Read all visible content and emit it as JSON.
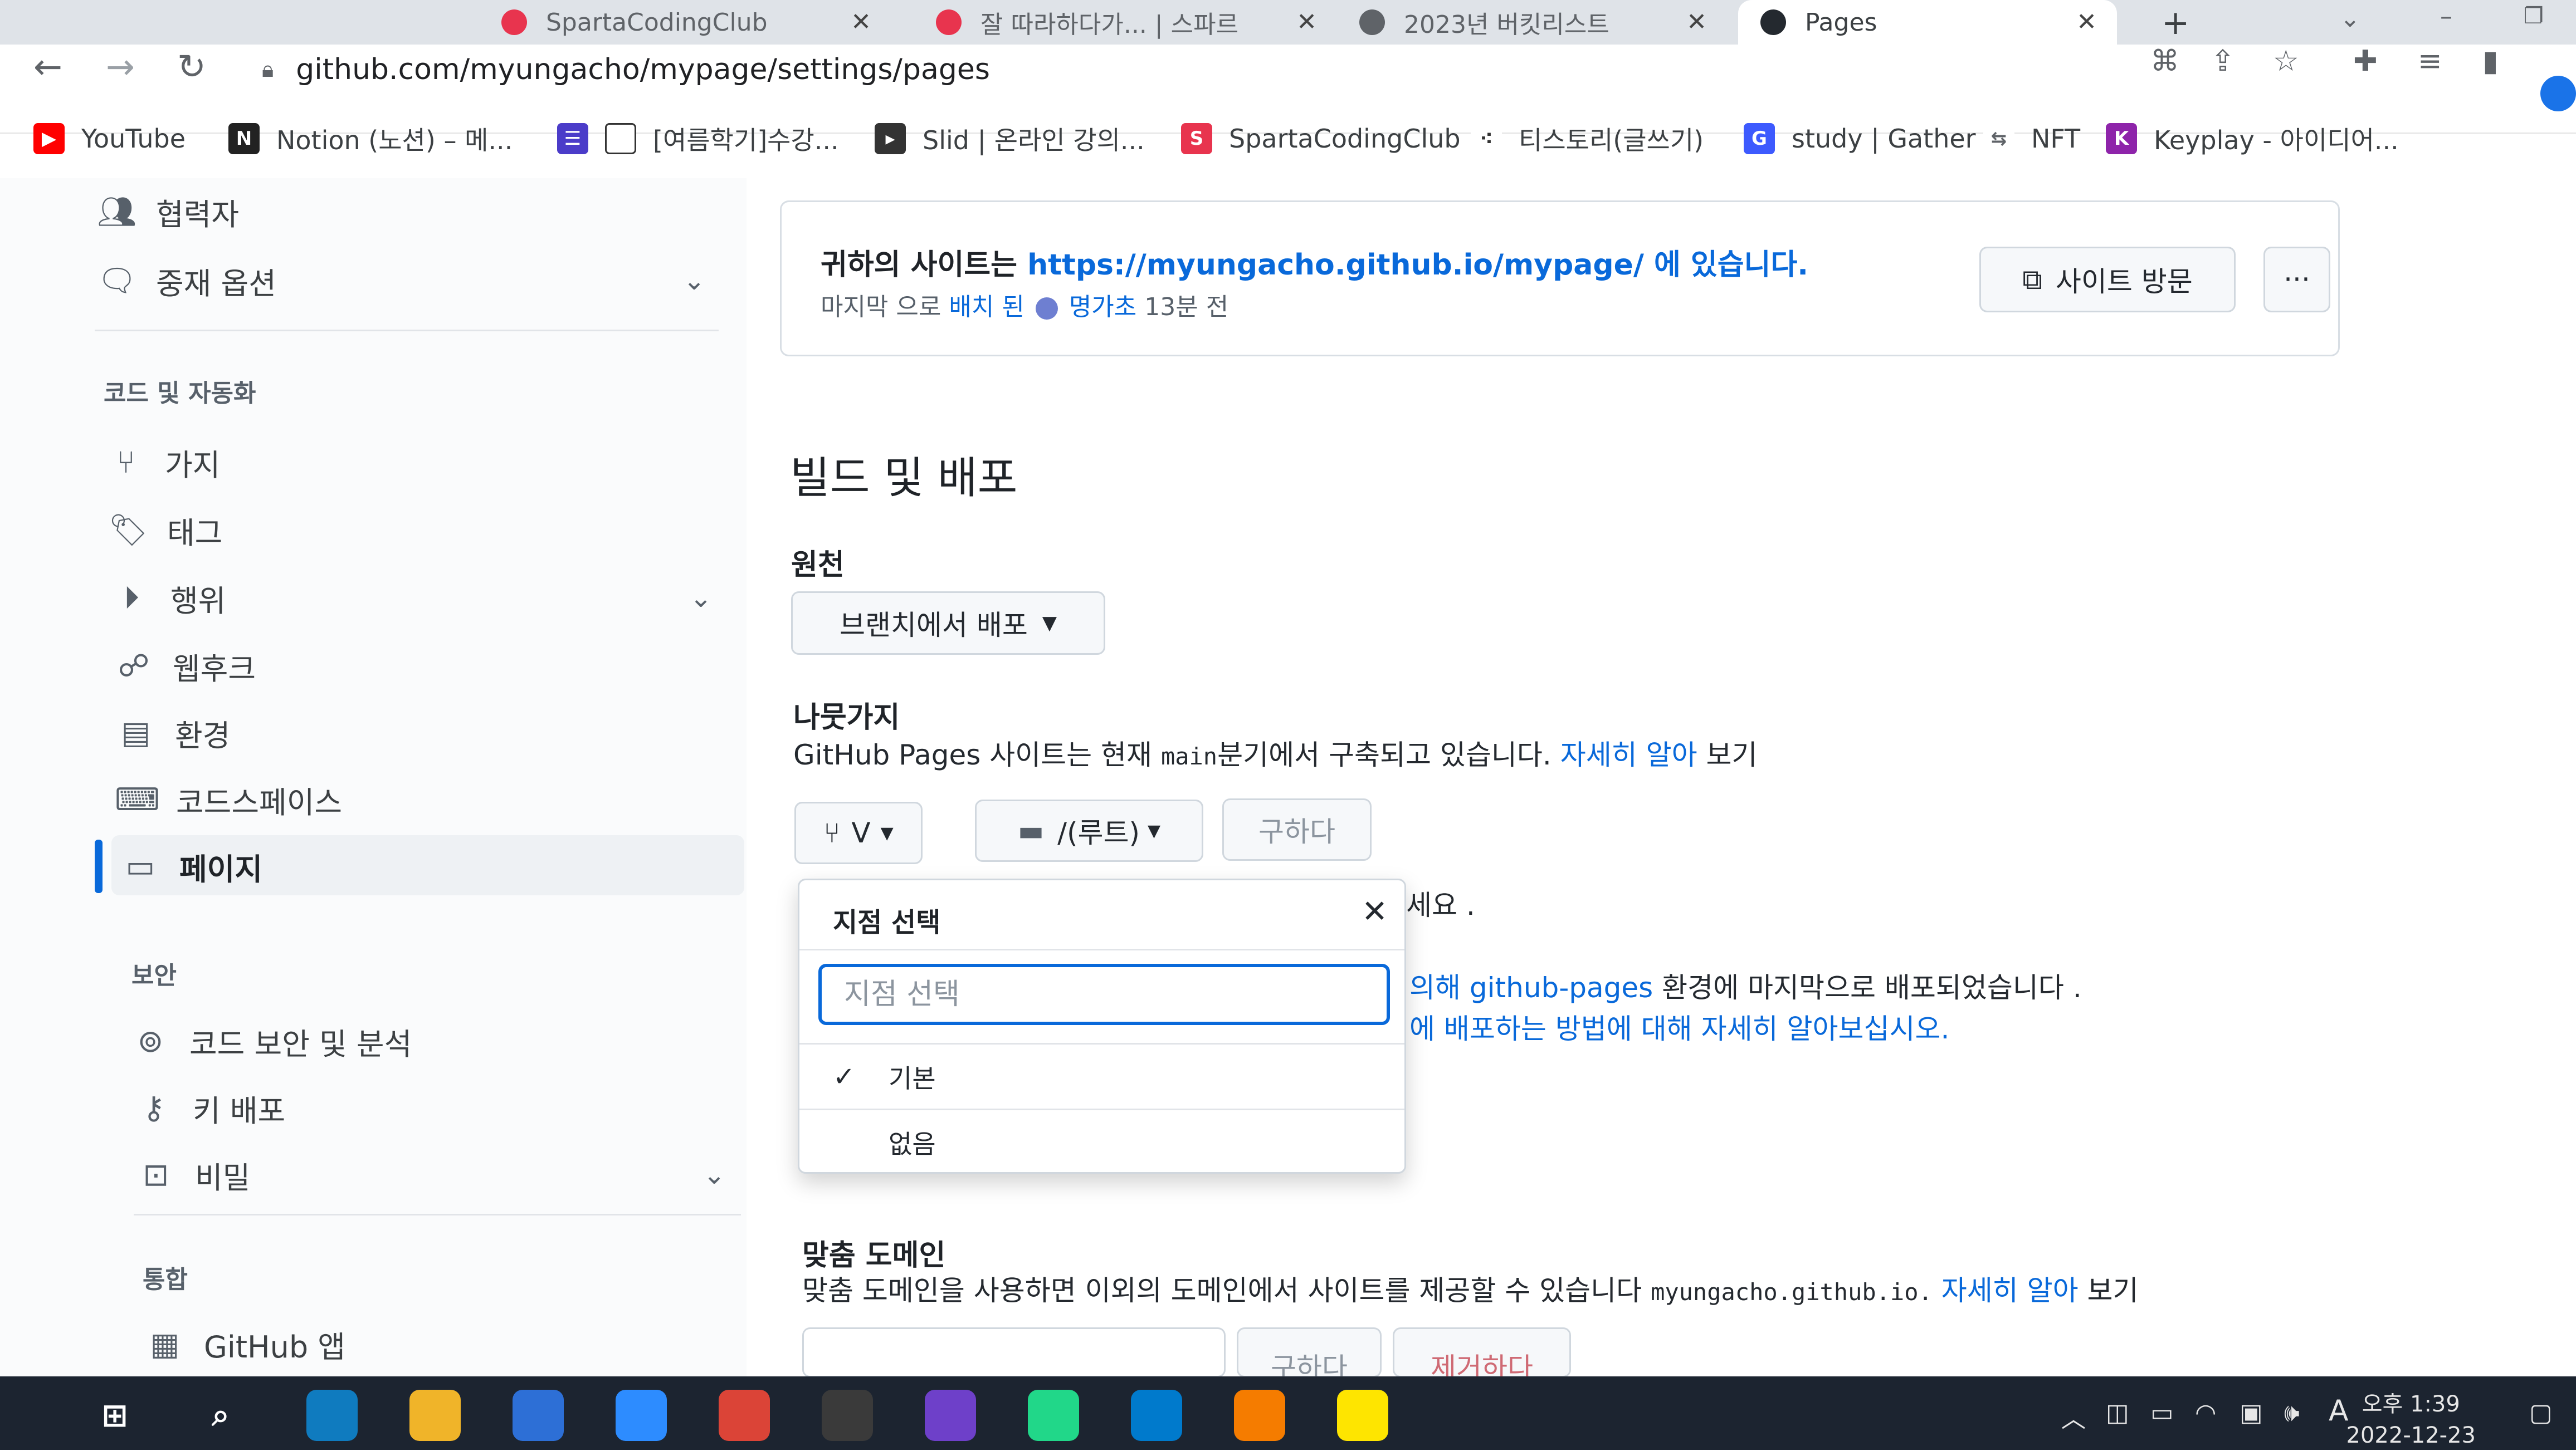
{
  "browser": {
    "tabs": [
      {
        "label": "SpartaCodingClub",
        "color": "#e8344e"
      },
      {
        "label": "잘 따라하다가... | 스파르",
        "color": "#e8344e"
      },
      {
        "label": "2023년 버킷리스트",
        "color": "#5f6368"
      },
      {
        "label": "Pages",
        "color": "#24292f"
      }
    ],
    "url": "github.com/myungacho/mypage/settings/pages",
    "bookmarks": [
      {
        "label": "YouTube",
        "color": "#ff0000"
      },
      {
        "label": "Notion (노션) – 메...",
        "color": "#222222"
      },
      {
        "label": "[여름학기]수강...",
        "color": "#4b3cc9"
      },
      {
        "label": "Slid | 온라인 강의...",
        "color": "#333333"
      },
      {
        "label": "SpartaCodingClub",
        "color": "#e8344e"
      },
      {
        "label": "티스토리(글쓰기)",
        "color": "#333333"
      },
      {
        "label": "study | Gather",
        "color": "#3d5afe"
      },
      {
        "label": "NFT",
        "color": "#5f6368"
      },
      {
        "label": "Keyplay - 아이디어...",
        "color": "#8e24aa"
      }
    ]
  },
  "sidebar": {
    "items_top": [
      {
        "label": "협력자",
        "icon": "people-icon"
      },
      {
        "label": "중재 옵션",
        "icon": "comment-icon"
      }
    ],
    "section_code": "코드 및 자동화",
    "items_code": [
      {
        "label": "가지",
        "icon": "branch-icon"
      },
      {
        "label": "태그",
        "icon": "tag-icon"
      },
      {
        "label": "행위",
        "icon": "play-icon"
      },
      {
        "label": "웹후크",
        "icon": "webhook-icon"
      },
      {
        "label": "환경",
        "icon": "server-icon"
      },
      {
        "label": "코드스페이스",
        "icon": "codespaces-icon"
      },
      {
        "label": "페이지",
        "icon": "browser-icon"
      }
    ],
    "section_security": "보안",
    "items_security": [
      {
        "label": "코드 보안 및 분석",
        "icon": "codescan-icon"
      },
      {
        "label": "키 배포",
        "icon": "key-icon"
      },
      {
        "label": "비밀",
        "icon": "secret-icon"
      }
    ],
    "section_integrations": "통합",
    "items_integrations": [
      {
        "label": "GitHub 앱",
        "icon": "apps-icon"
      }
    ]
  },
  "banner": {
    "prefix": "귀하의 사이트는",
    "url": "https://myungacho.github.io/mypage/",
    "suffix": "에 있습니다.",
    "sub_prefix": "마지막 으로",
    "sub_link": "배치 된",
    "sub_user": "명가초",
    "sub_time": "13분 전",
    "visit_button": "사이트 방문",
    "more_button": "···"
  },
  "build": {
    "title": "빌드 및 배포",
    "source_label": "원천",
    "source_value": "브랜치에서 배포",
    "branch_label": "나뭇가지",
    "branch_desc_prefix": "GitHub Pages 사이트는 현재",
    "branch_desc_code": "main",
    "branch_desc_mid": "분기에서 구축되고 있습니다.",
    "branch_desc_link": "자세히 알아",
    "branch_desc_suffix": "보기",
    "branch_button": "V",
    "folder_button": "/(루트)",
    "save_button": "구하다",
    "partial_text_1": "세요 .",
    "deploy_link_text": "의해",
    "deploy_env_link": "github-pages",
    "deploy_text": "환경에 마지막으로 배포되었습니다 .",
    "deploy_help_prefix": "에 배포하는 방법에 대해",
    "deploy_help_link": "자세히 알아보십시오."
  },
  "branch_menu": {
    "title": "지점 선택",
    "close": "✕",
    "search_placeholder": "지점 선택",
    "options": [
      {
        "label": "기본",
        "checked": true
      },
      {
        "label": "없음",
        "checked": false
      }
    ]
  },
  "custom_domain": {
    "label": "맞춤 도메인",
    "desc_prefix": "맞춤 도메인을 사용하면 이외의 도메인에서 사이트를 제공할 수 있습니다",
    "desc_code": "myungacho.github.io.",
    "desc_link": "자세히 알아",
    "desc_suffix": "보기",
    "save_button": "구하다",
    "remove_button": "제거하다"
  },
  "taskbar": {
    "apps": [
      {
        "name": "edge-icon",
        "color": "#0f7bbf"
      },
      {
        "name": "explorer-icon",
        "color": "#f0b429"
      },
      {
        "name": "link-icon",
        "color": "#2d6fd6"
      },
      {
        "name": "zoom-icon",
        "color": "#2d8cff"
      },
      {
        "name": "chrome-icon",
        "color": "#db4437"
      },
      {
        "name": "obs-icon",
        "color": "#3a3a3a"
      },
      {
        "name": "github-desktop-icon",
        "color": "#6e40c9"
      },
      {
        "name": "pycharm-icon",
        "color": "#21d789"
      },
      {
        "name": "vscode-icon",
        "color": "#007acc"
      },
      {
        "name": "notes-icon",
        "color": "#f57c00"
      },
      {
        "name": "kakaotalk-icon",
        "color": "#fee500"
      }
    ],
    "ime": "A",
    "time": "오후 1:39",
    "date": "2022-12-23"
  }
}
